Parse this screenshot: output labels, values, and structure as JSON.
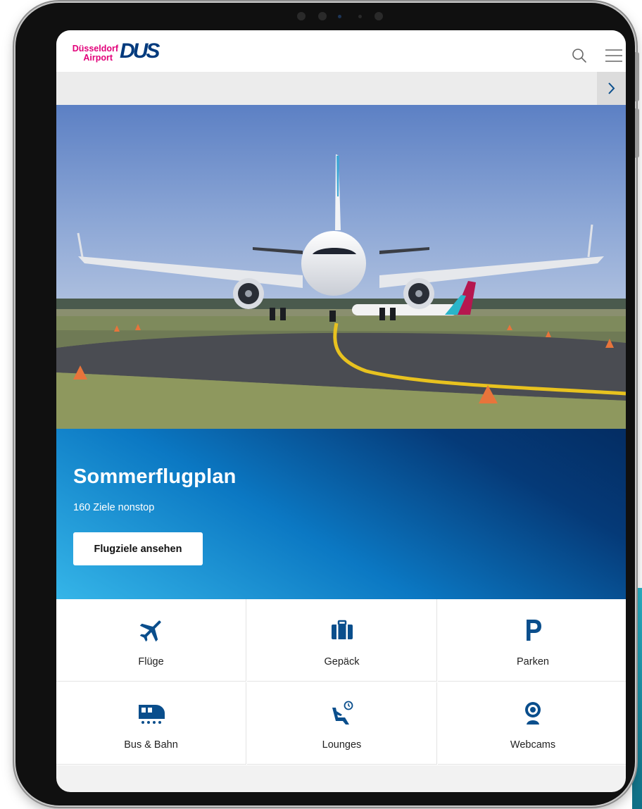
{
  "brand": {
    "city": "Düsseldorf",
    "word": "Airport",
    "code": "DUS",
    "color_pink": "#e2007a",
    "color_navy": "#003a7d"
  },
  "header": {
    "search_icon": "search-icon",
    "menu_icon": "hamburger-menu-icon"
  },
  "subbar": {
    "arrow_icon": "chevron-right-icon"
  },
  "hero": {
    "image_subject": "Airbus jet taxiing toward camera on runway with yellow centerline"
  },
  "promo": {
    "title": "Sommerflugplan",
    "subtitle": "160 Ziele nonstop",
    "button_label": "Flugziele ansehen",
    "gradient_start": "#35b5e8",
    "gradient_end": "#042d63"
  },
  "tiles": [
    {
      "label": "Flüge",
      "icon": "airplane-icon"
    },
    {
      "label": "Gepäck",
      "icon": "suitcase-icon"
    },
    {
      "label": "Parken",
      "icon": "parking-icon"
    },
    {
      "label": "Bus & Bahn",
      "icon": "train-icon"
    },
    {
      "label": "Lounges",
      "icon": "lounge-seat-icon"
    },
    {
      "label": "Webcams",
      "icon": "webcam-icon"
    }
  ],
  "icon_color": "#0a4e8c"
}
